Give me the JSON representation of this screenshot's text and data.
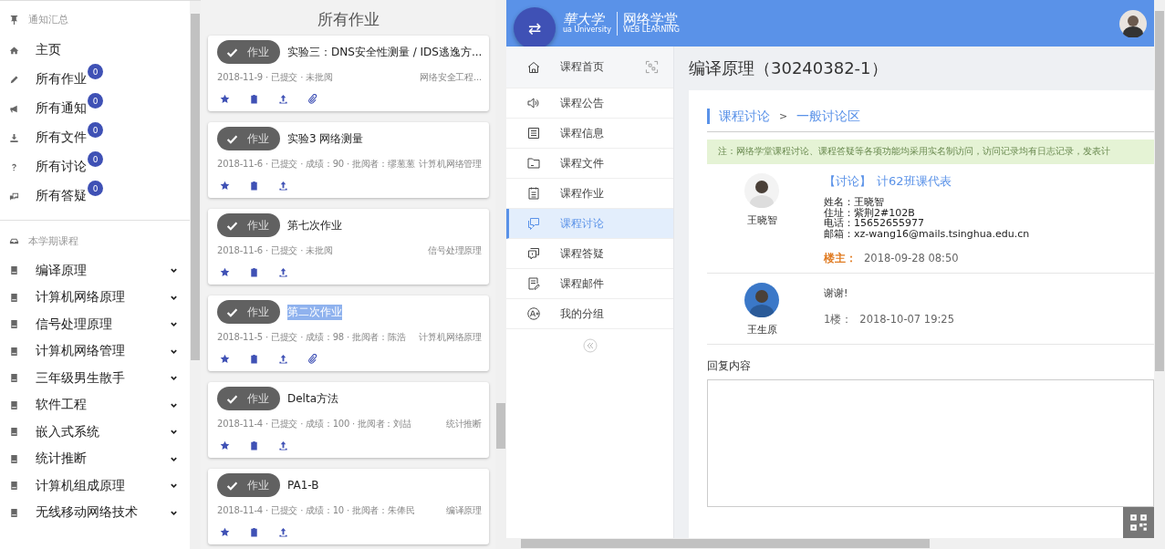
{
  "sidebar": {
    "summary_title": "通知汇总",
    "summary_items": [
      {
        "label": "主页"
      },
      {
        "label": "所有作业",
        "badge": "0"
      },
      {
        "label": "所有通知",
        "badge": "0"
      },
      {
        "label": "所有文件",
        "badge": "0"
      },
      {
        "label": "所有讨论",
        "badge": "0"
      },
      {
        "label": "所有答疑",
        "badge": "0"
      }
    ],
    "courses_title": "本学期课程",
    "courses": [
      {
        "label": "编译原理",
        "expanded": false
      },
      {
        "label": "计算机网络原理",
        "expanded": false
      },
      {
        "label": "信号处理原理",
        "expanded": false
      },
      {
        "label": "计算机网络管理",
        "expanded": false
      },
      {
        "label": "三年级男生散手",
        "expanded": false
      },
      {
        "label": "软件工程",
        "expanded": false
      },
      {
        "label": "嵌入式系统",
        "expanded": false
      },
      {
        "label": "统计推断",
        "expanded": false
      },
      {
        "label": "计算机组成原理",
        "expanded": false
      },
      {
        "label": "无线移动网络技术",
        "expanded": false
      }
    ]
  },
  "homework": {
    "title": "所有作业",
    "cards": [
      {
        "tag": "作业",
        "title": "实验三：DNS安全性测量 / IDS逃逸方...",
        "meta": "2018-11-9 · 已提交 · 未批阅",
        "course": "网络安全工程...",
        "attachment": true,
        "highlighted": false
      },
      {
        "tag": "作业",
        "title": "实验3 网络测量",
        "meta": "2018-11-6 · 已提交 · 成绩：90 · 批阅者：缪葱葱",
        "course": "计算机网络管理",
        "attachment": false,
        "highlighted": false
      },
      {
        "tag": "作业",
        "title": "第七次作业",
        "meta": "2018-11-6 · 已提交 · 未批阅",
        "course": "信号处理原理",
        "attachment": false,
        "highlighted": false
      },
      {
        "tag": "作业",
        "title": "第二次作业",
        "meta": "2018-11-5 · 已提交 · 成绩：98 · 批阅者：陈浩",
        "course": "计算机网络原理",
        "attachment": true,
        "highlighted": true
      },
      {
        "tag": "作业",
        "title": "Delta方法",
        "meta": "2018-11-4 · 已提交 · 成绩：100 · 批阅者：刘喆",
        "course": "统计推断",
        "attachment": false,
        "highlighted": false
      },
      {
        "tag": "作业",
        "title": "PA1-B",
        "meta": "2018-11-4 · 已提交 · 成绩：10 · 批阅者：朱俸民",
        "course": "编译原理",
        "attachment": false,
        "highlighted": false
      }
    ]
  },
  "web_learning": {
    "logo_seal": "華大学",
    "logo_sub": "ua University",
    "logo_title": "网络学堂",
    "logo_subtitle": "WEB LEARNING",
    "fab": "⇄",
    "nav": [
      {
        "label": "课程首页",
        "selected": false
      },
      {
        "label": "课程公告",
        "selected": false
      },
      {
        "label": "课程信息",
        "selected": false
      },
      {
        "label": "课程文件",
        "selected": false
      },
      {
        "label": "课程作业",
        "selected": false
      },
      {
        "label": "课程讨论",
        "selected": true
      },
      {
        "label": "课程答疑",
        "selected": false
      },
      {
        "label": "课程邮件",
        "selected": false
      },
      {
        "label": "我的分组",
        "selected": false
      }
    ],
    "course_title": "编译原理（30240382-1）",
    "breadcrumb": [
      "课程讨论",
      ">",
      "一般讨论区"
    ],
    "notice": "注：网络学堂课程讨论、课程答疑等各项功能均采用实名制访问，访问记录均有日志记录，发表计",
    "posts": [
      {
        "author": "王晓智",
        "topic_tag": "【讨论】",
        "topic": "计62班课代表",
        "lines": [
          "姓名：王晓智",
          "住址：紫荆2#102B",
          "电话：15652655977",
          "邮箱：xz-wang16@mails.tsinghua.edu.cn"
        ],
        "floor_label": "楼主：",
        "time": "2018-09-28 08:50"
      },
      {
        "author": "王生原",
        "body": "谢谢!",
        "floor_label": "1楼：",
        "time": "2018-10-07 19:25"
      }
    ],
    "reply_label": "回复内容"
  }
}
